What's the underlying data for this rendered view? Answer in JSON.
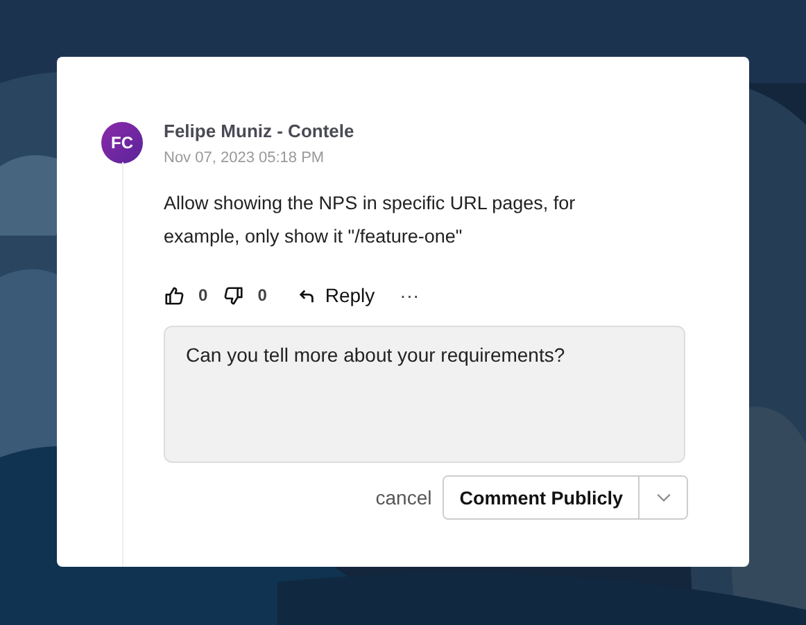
{
  "comment": {
    "avatar": "FC",
    "author": "Felipe Muniz - Contele",
    "date": "Nov 07, 2023 05:18 PM",
    "body": "Allow showing the NPS in specific URL pages, for example, only show it \"/feature-one\"",
    "likes": "0",
    "dislikes": "0",
    "reply": "Reply",
    "more": "···"
  },
  "reply_box": {
    "value": "Can you tell more about your requirements?"
  },
  "actions": {
    "cancel": "cancel",
    "submit": "Comment Publicly"
  }
}
